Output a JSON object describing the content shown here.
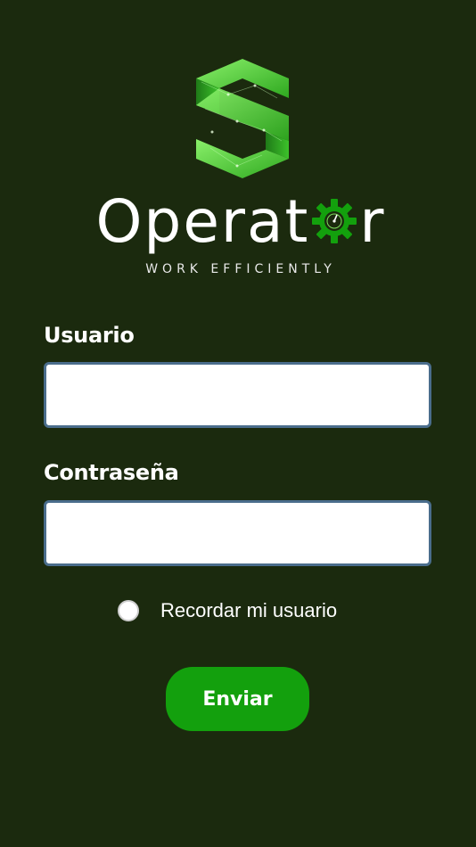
{
  "brand": {
    "name_start": "Operat",
    "name_end": "r",
    "tagline": "WORK EFFICIENTLY",
    "accent": "#13a00d",
    "logo_green_light": "#6fe24f",
    "logo_green_dark": "#1b8a17"
  },
  "form": {
    "username_label": "Usuario",
    "username_value": "",
    "password_label": "Contraseña",
    "password_value": "",
    "remember_label": "Recordar mi usuario",
    "remember_checked": false,
    "submit_label": "Enviar"
  },
  "colors": {
    "background": "#1b2a0e",
    "input_border": "#4a6d8c",
    "button": "#13a00d"
  }
}
